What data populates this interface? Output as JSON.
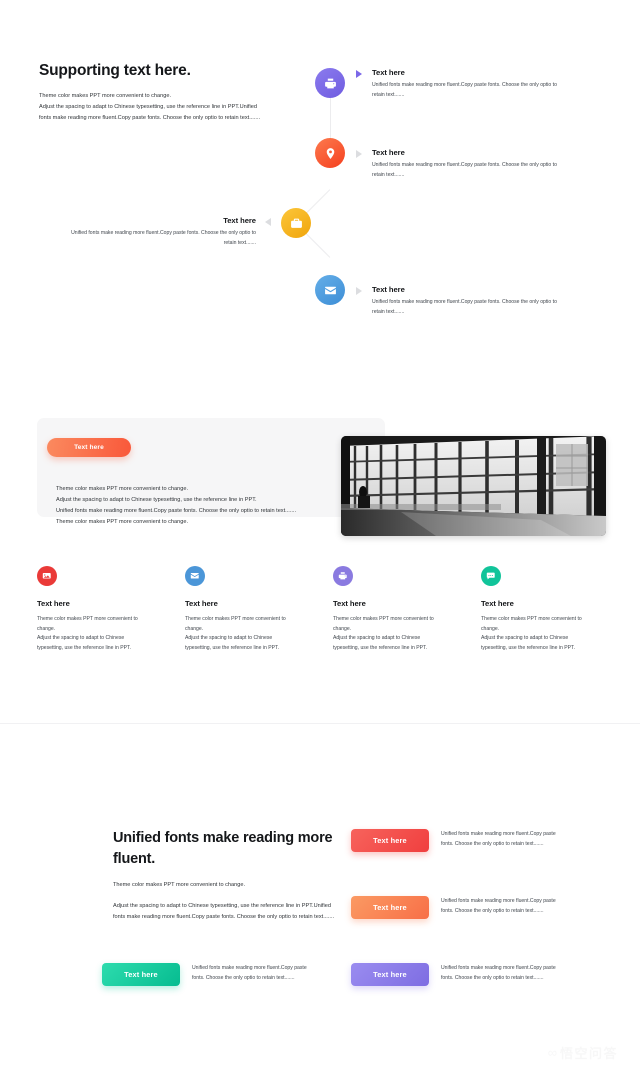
{
  "section1": {
    "title": "Supporting text here.",
    "lead": "Theme  color makes PPT more convenient to change.\nAdjust the spacing to adapt to Chinese typesetting, use the reference line in PPT.Unified fonts make reading more fluent.Copy paste fonts. Choose the only optio to retain text.......",
    "items": [
      {
        "title": "Text here",
        "body": "Unified fonts make reading more fluent.Copy paste fonts. Choose the only optio to retain text.......",
        "icon": "printer-icon",
        "color": "#7b68e8",
        "side": "right"
      },
      {
        "title": "Text here",
        "body": "Unified fonts make reading more fluent.Copy paste fonts. Choose the only optio to retain text.......",
        "icon": "target-pin-icon",
        "color": "#fa5a2e",
        "side": "right"
      },
      {
        "title": "Text here",
        "body": "Unified fonts make reading more fluent.Copy paste fonts. Choose the only optio to retain text.......",
        "icon": "briefcase-icon",
        "color": "#f6b11d",
        "side": "left"
      },
      {
        "title": "Text here",
        "body": "Unified fonts make reading more fluent.Copy paste fonts. Choose the only optio to retain text.......",
        "icon": "envelope-icon",
        "color": "#4c9de0",
        "side": "right"
      }
    ]
  },
  "section2": {
    "pill_label": "Text here",
    "pill_color": "#fa7050",
    "card_text": "Theme  color makes PPT more convenient to change.\nAdjust the spacing to adapt to Chinese typesetting, use the reference line in PPT.\nUnified fonts make reading more fluent.Copy paste fonts. Choose the only optio to retain text.......\nTheme  color makes PPT more convenient to change.",
    "photo_alt": "black-and-white corridor with tall windows",
    "columns": [
      {
        "title": "Text here",
        "body": "Theme  color makes PPT more convenient to change.\nAdjust the spacing to adapt to Chinese typesetting, use the reference line in PPT.",
        "icon": "image-icon",
        "color": "#ea3a38"
      },
      {
        "title": "Text here",
        "body": "Theme  color makes PPT more convenient to change.\nAdjust the spacing to adapt to Chinese typesetting, use the reference line in PPT.",
        "icon": "envelope-icon",
        "color": "#4b96d8"
      },
      {
        "title": "Text here",
        "body": "Theme  color makes PPT more convenient to change.\nAdjust the spacing to adapt to Chinese typesetting, use the reference line in PPT.",
        "icon": "printer-icon",
        "color": "#8a7ae0"
      },
      {
        "title": "Text here",
        "body": "Theme  color makes PPT more convenient to change.\nAdjust the spacing to adapt to Chinese typesetting, use the reference line in PPT.",
        "icon": "chat-icon",
        "color": "#11c49a"
      }
    ]
  },
  "section3": {
    "title": "Unified fonts make reading more fluent.",
    "paragraph1": "Theme  color makes PPT more convenient to change.",
    "paragraph2": "Adjust the spacing to adapt to Chinese typesetting, use the reference line in PPT.Unified fonts make reading more fluent.Copy paste fonts. Choose the only optio to retain text.......",
    "buttons": [
      {
        "label": "Text here",
        "color": "#f4524d",
        "body": "Unified fonts make reading more fluent.Copy paste fonts. Choose the only optio to retain text......."
      },
      {
        "label": "Text here",
        "color": "#fa8354",
        "body": "Unified fonts make reading more fluent.Copy paste fonts. Choose the only optio to retain text......."
      },
      {
        "label": "Text here",
        "color": "#10c79c",
        "body": "Unified fonts make reading more fluent.Copy paste fonts. Choose the only optio to retain text......."
      },
      {
        "label": "Text here",
        "color": "#8b7ce8",
        "body": "Unified fonts make reading more fluent.Copy paste fonts. Choose the only optio to retain text......."
      }
    ]
  },
  "watermark": {
    "logo": "∞",
    "text": "悟空问答"
  }
}
